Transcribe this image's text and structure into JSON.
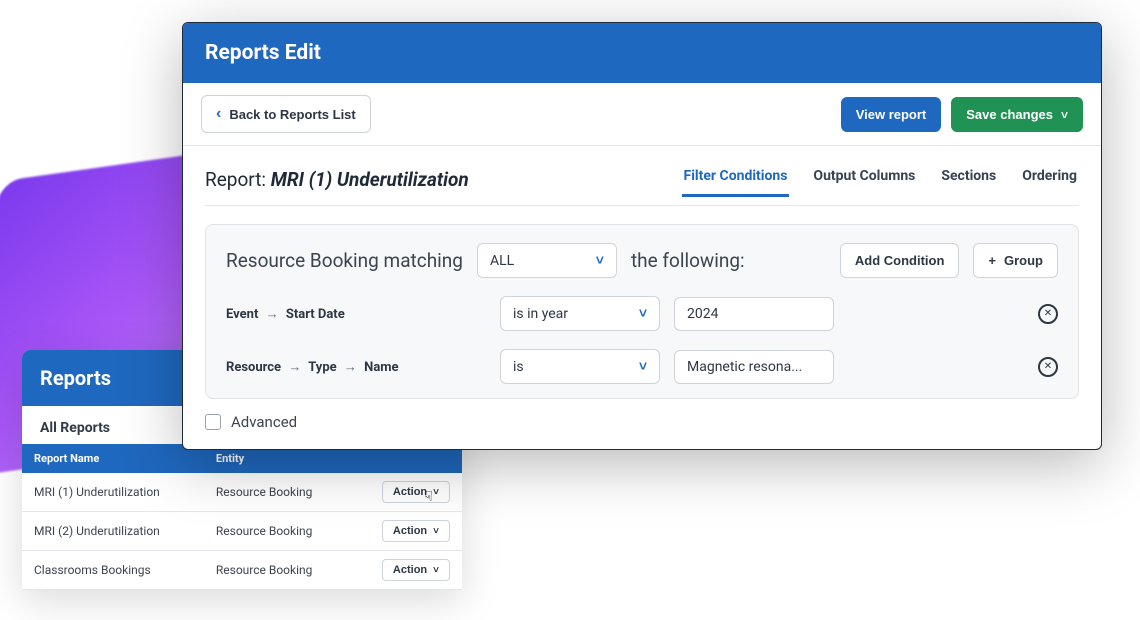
{
  "front": {
    "header": "Reports Edit",
    "back_link": "Back to Reports List",
    "view_btn": "View report",
    "save_btn": "Save changes",
    "title_prefix": "Report:",
    "report_name": "MRI (1) Underutilization",
    "tabs": [
      "Filter Conditions",
      "Output Columns",
      "Sections",
      "Ordering"
    ],
    "active_tab": 0,
    "match_text_a": "Resource Booking matching",
    "match_mode": "ALL",
    "match_text_b": "the following:",
    "add_condition": "Add Condition",
    "group_btn": "Group",
    "conditions": [
      {
        "path": [
          "Event",
          "Start Date"
        ],
        "op": "is in year",
        "value": "2024"
      },
      {
        "path": [
          "Resource",
          "Type",
          "Name"
        ],
        "op": "is",
        "value": "Magnetic resona..."
      }
    ],
    "advanced_label": "Advanced"
  },
  "back": {
    "header": "Reports",
    "subheader": "All Reports",
    "columns": [
      "Report Name",
      "Entity"
    ],
    "action_label": "Action",
    "rows": [
      {
        "name": "MRI (1) Underutilization",
        "entity": "Resource Booking"
      },
      {
        "name": "MRI (2) Underutilization",
        "entity": "Resource Booking"
      },
      {
        "name": "Classrooms Bookings",
        "entity": "Resource Booking"
      }
    ]
  }
}
